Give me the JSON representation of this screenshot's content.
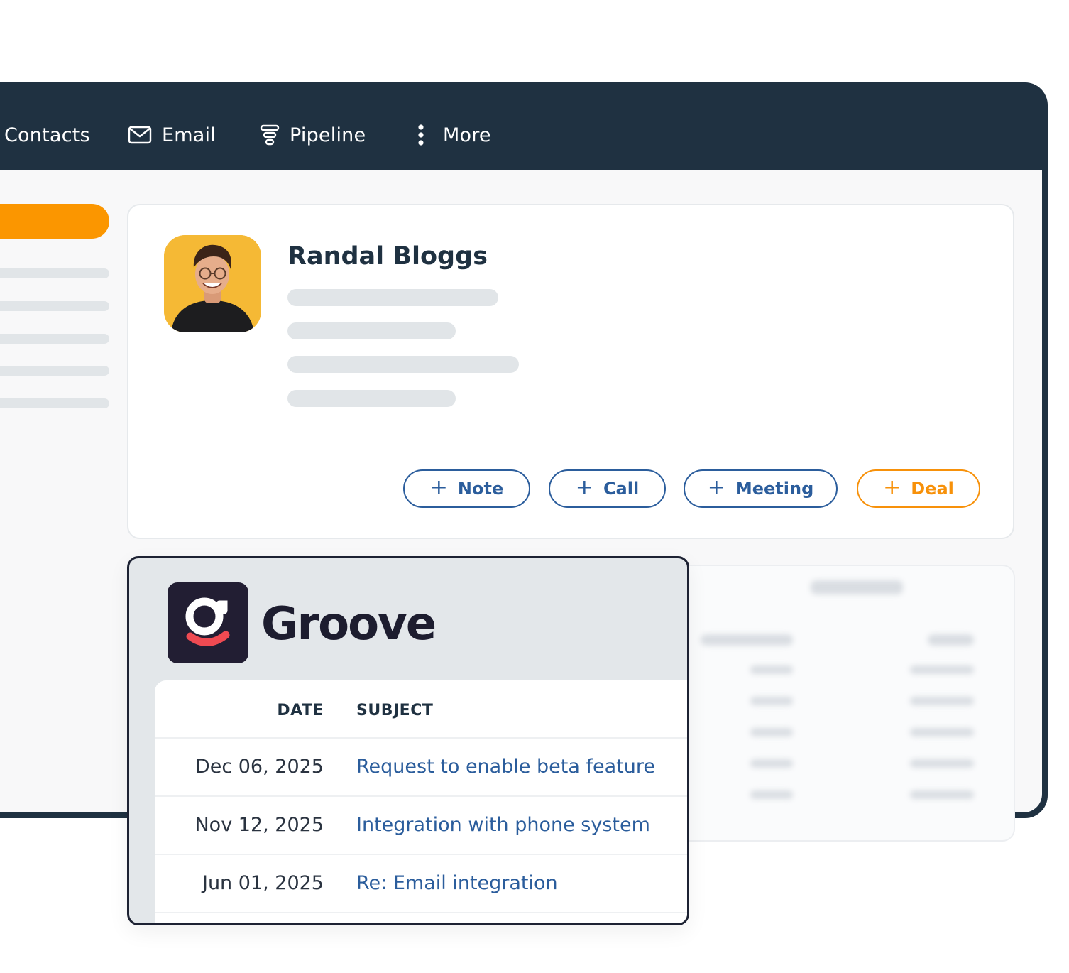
{
  "nav": {
    "items": [
      {
        "label": "Contacts",
        "icon": "contacts-icon"
      },
      {
        "label": "Email",
        "icon": "envelope-icon"
      },
      {
        "label": "Pipeline",
        "icon": "funnel-icon"
      },
      {
        "label": "More",
        "icon": "vertical-dots-icon"
      }
    ]
  },
  "contact": {
    "name": "Randal Bloggs",
    "actions": [
      {
        "label": "Note"
      },
      {
        "label": "Call"
      },
      {
        "label": "Meeting"
      },
      {
        "label": "Deal"
      }
    ]
  },
  "groove": {
    "brand": "Groove",
    "columns": {
      "date": "DATE",
      "subject": "SUBJECT"
    },
    "rows": [
      {
        "date": "Dec 06, 2025",
        "subject": "Request to enable beta feature"
      },
      {
        "date": "Nov 12, 2025",
        "subject": "Integration with phone system"
      },
      {
        "date": "Jun 01, 2025",
        "subject": "Re: Email integration"
      }
    ]
  },
  "colors": {
    "nav_bg": "#1f3141",
    "accent_orange": "#f7910a",
    "link_blue": "#2b5d9c",
    "groove_logo_bg": "#221e33",
    "groove_logo_red": "#ef4a52"
  }
}
